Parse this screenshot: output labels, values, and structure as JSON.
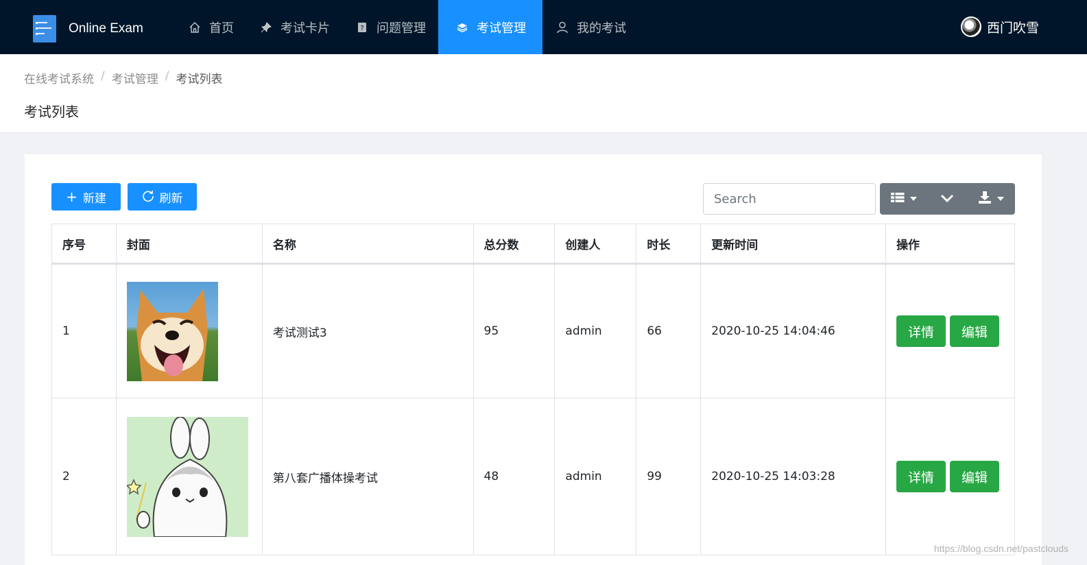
{
  "app": {
    "title": "Online Exam"
  },
  "nav": {
    "items": [
      {
        "label": "首页",
        "icon": "home-icon"
      },
      {
        "label": "考试卡片",
        "icon": "pin-icon"
      },
      {
        "label": "问题管理",
        "icon": "question-book-icon"
      },
      {
        "label": "考试管理",
        "icon": "stack-icon",
        "active": true
      },
      {
        "label": "我的考试",
        "icon": "user-icon"
      }
    ]
  },
  "user": {
    "name": "西门吹雪"
  },
  "breadcrumb": [
    "在线考试系统",
    "考试管理",
    "考试列表"
  ],
  "page": {
    "title": "考试列表"
  },
  "toolbar": {
    "new_label": "新建",
    "refresh_label": "刷新",
    "search_placeholder": "Search",
    "tools": [
      "list-view-icon",
      "chevron-down-icon",
      "download-icon"
    ]
  },
  "table": {
    "columns": [
      "序号",
      "封面",
      "名称",
      "总分数",
      "创建人",
      "时长",
      "更新时间",
      "操作"
    ],
    "rows": [
      {
        "index": "1",
        "name": "考试测试3",
        "score": "95",
        "creator": "admin",
        "duration": "66",
        "updated": "2020-10-25 14:04:46",
        "cover": "dog-photo"
      },
      {
        "index": "2",
        "name": "第八套广播体操考试",
        "score": "48",
        "creator": "admin",
        "duration": "99",
        "updated": "2020-10-25 14:03:28",
        "cover": "bunny-illustration"
      }
    ],
    "actions": {
      "detail": "详情",
      "edit": "编辑"
    }
  },
  "watermark": "https://blog.csdn.net/pastclouds",
  "colors": {
    "nav_bg": "#001529",
    "primary": "#1890ff",
    "success": "#28a745",
    "tool_bg": "#6c757d"
  }
}
